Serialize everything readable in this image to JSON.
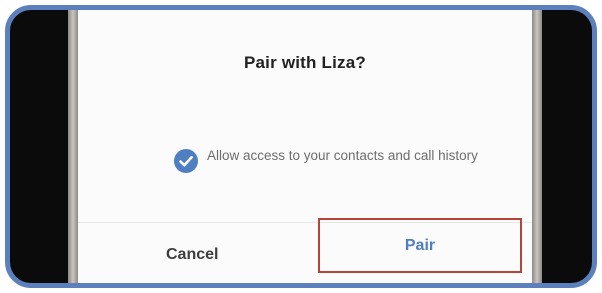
{
  "dialog": {
    "title": "Pair with Liza?",
    "permission": {
      "checked": true,
      "label": "Allow access to your contacts and call history"
    },
    "buttons": {
      "cancel_label": "Cancel",
      "pair_label": "Pair"
    }
  },
  "colors": {
    "frame_border": "#5b80bd",
    "accent": "#4f7fc0",
    "highlight_box": "#b3453d",
    "title_text": "#222222",
    "body_text": "#6d6d6d"
  },
  "icons": {
    "checkbox": "check-circle-icon"
  }
}
